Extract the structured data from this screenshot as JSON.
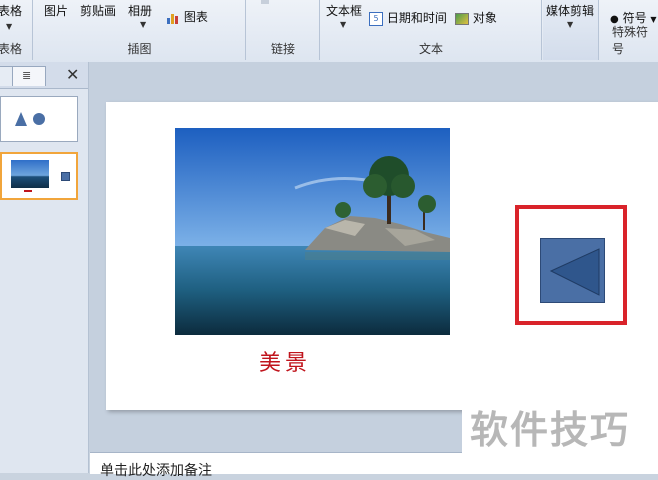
{
  "ribbon": {
    "table": {
      "label": "表格",
      "group_label": "表格"
    },
    "images": {
      "picture": "图片",
      "clipart": "剪贴画",
      "album": "相册",
      "chart": "图表",
      "group_label": "插图"
    },
    "links": {
      "group_label": "链接"
    },
    "text": {
      "textbox": "文本框",
      "datetime": "日期和时间",
      "object": "对象",
      "group_label": "文本"
    },
    "media": {
      "label": "媒体剪辑"
    },
    "symbols": {
      "symbol": "符号",
      "group_label": "特殊符号"
    }
  },
  "slide": {
    "caption": "美景",
    "photo_description_icon": "island-photo"
  },
  "notes": {
    "placeholder": "单击此处添加备注"
  },
  "watermark": {
    "text": "软件技巧"
  },
  "colors": {
    "caption": "#c0141c",
    "back_button": "#4a6fa5",
    "highlight_border": "#d9232a"
  }
}
